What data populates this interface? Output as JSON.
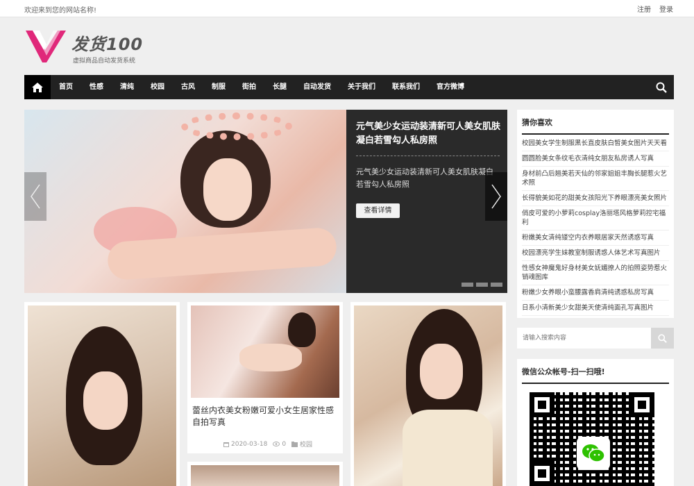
{
  "topbar": {
    "welcome": "欢迎来到您的网站名称!",
    "register": "注册",
    "login": "登录"
  },
  "logo": {
    "name": "发货100",
    "slogan": "虚拟商品自动发货系统",
    "brand_color": "#e0287a"
  },
  "nav": {
    "items": [
      "首页",
      "性感",
      "清纯",
      "校园",
      "古风",
      "制服",
      "街拍",
      "长腿",
      "自动发货",
      "关于我们",
      "联系我们",
      "官方微博"
    ],
    "icons": {
      "home": "home-icon",
      "search": "search-icon"
    }
  },
  "slider": {
    "title": "元气美少女运动装清新可人美女肌肤凝白若雪勾人私房照",
    "desc": "元气美少女运动装清新可人美女肌肤凝白若雪勾人私房照",
    "more_label": "查看详情"
  },
  "posts": [
    {
      "caption": "蕾丝内衣美女粉嫩可爱小女生居家性感自拍写真",
      "date": "2020-03-18",
      "views": "0",
      "category": "校园"
    }
  ],
  "sidebar": {
    "guess_title": "猜你喜欢",
    "guess_items": [
      "校园美女学生制服黑长直皮肤白皙美女图片天天看",
      "圆圆脸美女条纹毛衣清纯女朋友私房诱人写真",
      "身材前凸后翘美若天仙的邻家姐姐丰胸长腿惹火艺术照",
      "长得貌美如花的甜美女孩阳光下养眼漂亮美女照片",
      "俏皮可爱的小萝莉cosplay洛丽塔风格萝莉控宅福利",
      "粉嫩美女清纯镂空内衣养眼居家天然诱惑写真",
      "校园漂亮学生妹教室制服诱惑人体艺术写真图片",
      "性感女神魔鬼好身材美女妩媚撩人的拍照姿势惹火销魂图库",
      "粉嫩少女养眼小蛮腰露香肩清纯诱惑私房写真",
      "日系小清新美少女甜美天使清纯面孔写真图片"
    ],
    "search_placeholder": "请输入搜索内容",
    "wechat_title": "微信公众帐号-扫一扫哦!"
  }
}
